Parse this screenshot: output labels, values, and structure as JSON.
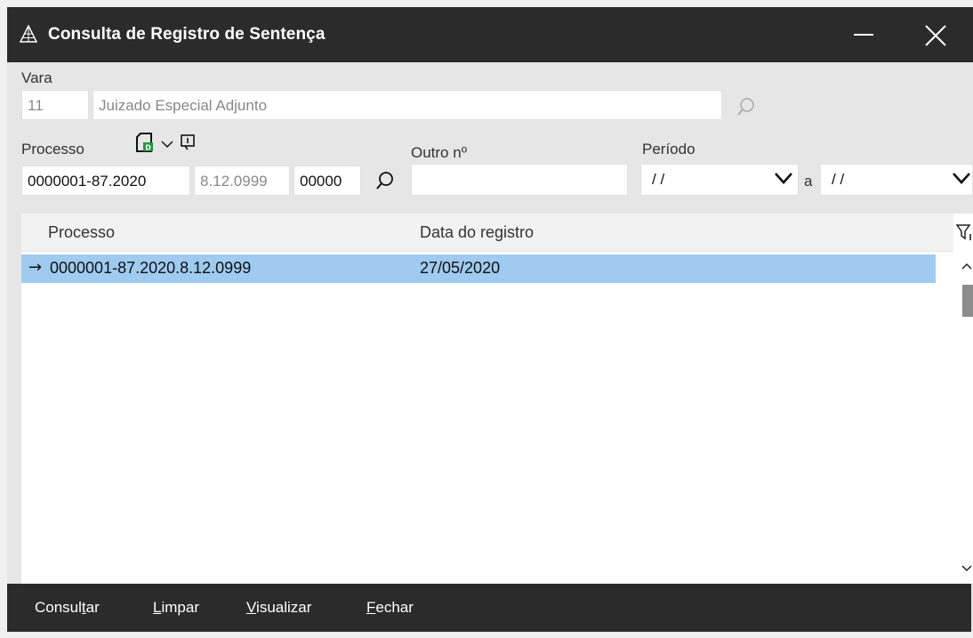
{
  "window": {
    "title": "Consulta de Registro de Sentença",
    "icons": {
      "app": "triangle-logo-icon",
      "minimize": "minimize-icon",
      "close": "close-icon"
    }
  },
  "form": {
    "vara_label": "Vara",
    "vara_code": "11",
    "vara_name": "Juizado Especial Adjunto",
    "processo_label": "Processo",
    "processo_part1": "0000001-87.2020",
    "processo_part2": "8.12.0999",
    "processo_part3": "00000",
    "outro_label": "Outro nº",
    "outro_value": "",
    "periodo_label": "Período",
    "periodo_start": "/ /",
    "periodo_sep": "a",
    "periodo_end": "/ /"
  },
  "grid": {
    "columns": [
      "Processo",
      "Data do registro"
    ],
    "rows": [
      {
        "processo": "0000001-87.2020.8.12.0999",
        "data": "27/05/2020",
        "selected": true
      }
    ]
  },
  "toolbar": {
    "consultar_pre": "Consul",
    "consultar_mn": "t",
    "consultar_post": "ar",
    "limpar_mn": "L",
    "limpar_post": "impar",
    "visualizar_mn": "V",
    "visualizar_post": "isualizar",
    "fechar_mn": "F",
    "fechar_post": "echar"
  }
}
